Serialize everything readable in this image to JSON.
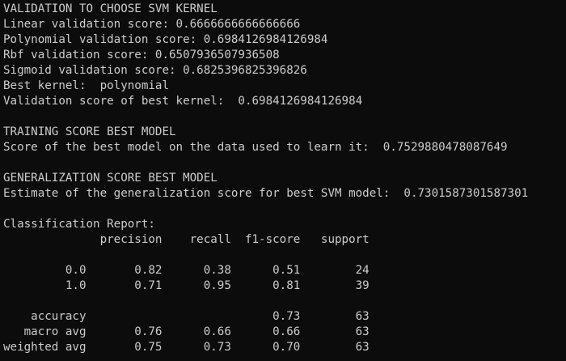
{
  "terminal": {
    "lines": [
      "VALIDATION TO CHOOSE SVM KERNEL",
      "Linear validation score: 0.6666666666666666",
      "Polynomial validation score: 0.6984126984126984",
      "Rbf validation score: 0.6507936507936508",
      "Sigmoid validation score: 0.6825396825396826",
      "Best kernel:  polynomial",
      "Validation score of best kernel:  0.6984126984126984",
      "",
      "TRAINING SCORE BEST MODEL",
      "Score of the best model on the data used to learn it:  0.7529880478087649",
      "",
      "GENERALIZATION SCORE BEST MODEL",
      "Estimate of the generalization score for best SVM model:  0.7301587301587301",
      "",
      "Classification Report:",
      "              precision    recall  f1-score   support",
      "",
      "         0.0       0.82      0.38      0.51        24",
      "         1.0       0.71      0.95      0.81        39",
      "",
      "    accuracy                           0.73        63",
      "   macro avg       0.76      0.66      0.66        63",
      "weighted avg       0.75      0.73      0.70        63"
    ]
  }
}
